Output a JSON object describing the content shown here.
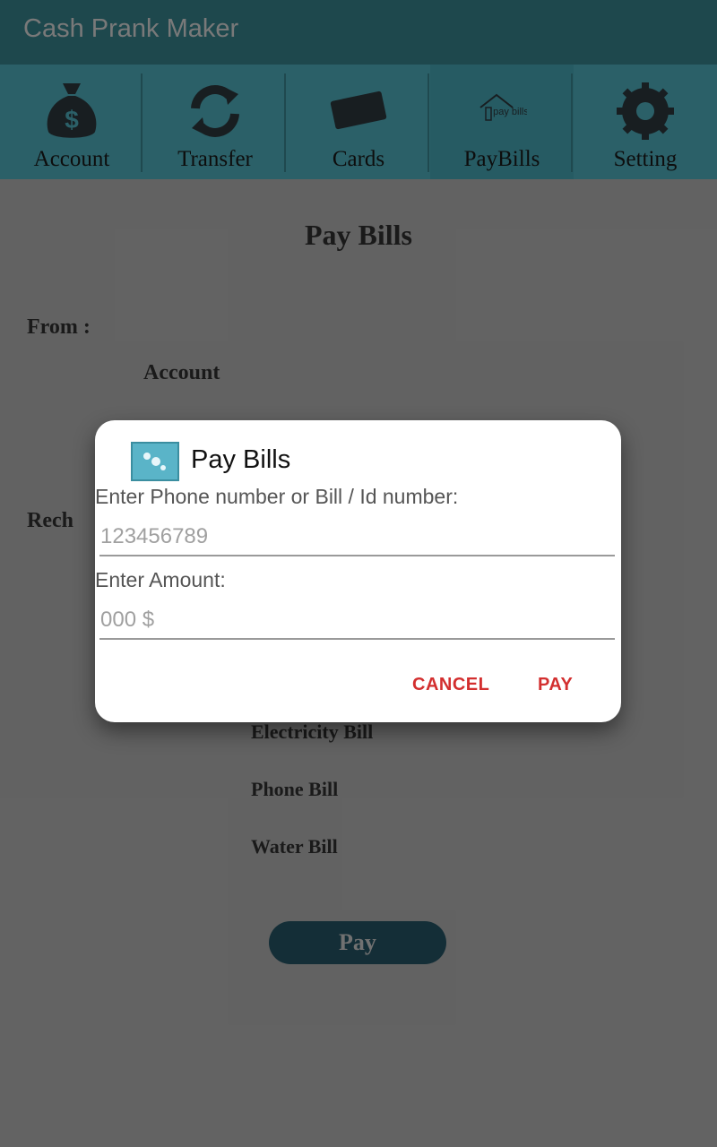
{
  "app": {
    "title": "Cash Prank Maker"
  },
  "tabs": [
    {
      "label": "Account",
      "icon": "money-bag-icon"
    },
    {
      "label": "Transfer",
      "icon": "refresh-arrows-icon"
    },
    {
      "label": "Cards",
      "icon": "card-icon"
    },
    {
      "label": "PayBills",
      "icon": "paybills-icon",
      "icon_text": "pay bills"
    },
    {
      "label": "Setting",
      "icon": "gear-icon"
    }
  ],
  "page": {
    "title": "Pay Bills",
    "from_label": "From :",
    "account_label": "Account",
    "recharge_label": "Rech",
    "bill_options": [
      "Electricity Bill",
      "Phone Bill",
      "Water Bill"
    ],
    "pay_button": "Pay"
  },
  "dialog": {
    "title": "Pay Bills",
    "phone_label": "Enter Phone number or Bill / Id number:",
    "phone_placeholder": "123456789",
    "amount_label": "Enter Amount:",
    "amount_placeholder": "000 $",
    "cancel": "CANCEL",
    "pay": "PAY"
  },
  "colors": {
    "appbar": "#3a8a94",
    "tabbar": "#53b9c8",
    "accent": "#d32f2f",
    "pay_button": "#27596a"
  }
}
